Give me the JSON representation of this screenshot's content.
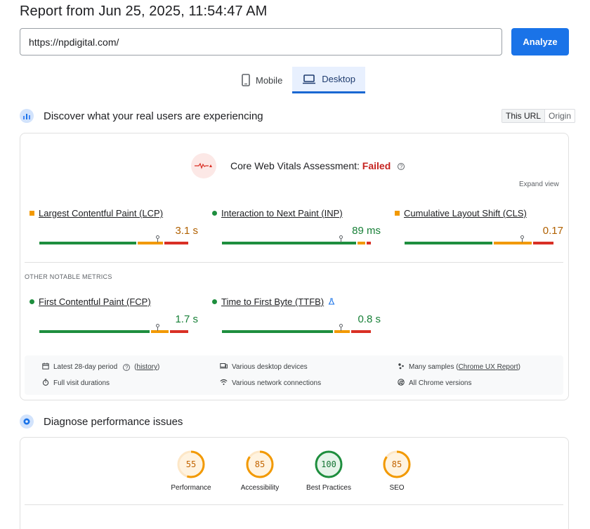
{
  "report_title": "Report from Jun 25, 2025, 11:54:47 AM",
  "url_input": {
    "value": "https://npdigital.com/"
  },
  "analyze_label": "Analyze",
  "tabs": [
    {
      "label": "Mobile",
      "icon": "phone-icon",
      "active": false
    },
    {
      "label": "Desktop",
      "icon": "laptop-icon",
      "active": true
    }
  ],
  "field_section": {
    "title": "Discover what your real users are experiencing",
    "toggle": {
      "this_url": "This URL",
      "origin": "Origin",
      "selected": "This URL"
    }
  },
  "cwv": {
    "label": "Core Web Vitals Assessment:",
    "status": "Failed",
    "help": "?",
    "expand_view": "Expand view"
  },
  "core_metrics": [
    {
      "name": "Largest Contentful Paint (LCP)",
      "value": "3.1 s",
      "status": "needs-improvement",
      "indicator": "orange-square"
    },
    {
      "name": "Interaction to Next Paint (INP)",
      "value": "89 ms",
      "status": "good",
      "indicator": "green-dot"
    },
    {
      "name": "Cumulative Layout Shift (CLS)",
      "value": "0.17",
      "status": "needs-improvement",
      "indicator": "orange-square"
    }
  ],
  "other_label": "OTHER NOTABLE METRICS",
  "other_metrics": [
    {
      "name": "First Contentful Paint (FCP)",
      "value": "1.7 s",
      "status": "good",
      "indicator": "green-dot"
    },
    {
      "name": "Time to First Byte (TTFB)",
      "value": "0.8 s",
      "status": "good",
      "indicator": "green-dot",
      "extra_icon": "flask-icon"
    }
  ],
  "info": {
    "period": "Latest 28-day period",
    "history": "history",
    "devices": "Various desktop devices",
    "samples_prefix": "Many samples (",
    "samples_link": "Chrome UX Report",
    "samples_suffix": ")",
    "durations": "Full visit durations",
    "network": "Various network connections",
    "chrome": "All Chrome versions"
  },
  "diagnose_section": {
    "title": "Diagnose performance issues"
  },
  "scores": [
    {
      "label": "Performance",
      "value": "55",
      "rating": "average"
    },
    {
      "label": "Accessibility",
      "value": "85",
      "rating": "average"
    },
    {
      "label": "Best Practices",
      "value": "100",
      "rating": "pass"
    },
    {
      "label": "SEO",
      "value": "85",
      "rating": "average"
    }
  ],
  "colors": {
    "good": "#1e8e3e",
    "average": "#e8710a",
    "poor": "#d93025",
    "accent": "#1a73e8",
    "fail": "#c5221f",
    "needs_improvement_text": "#b06000",
    "good_text": "#188038"
  }
}
